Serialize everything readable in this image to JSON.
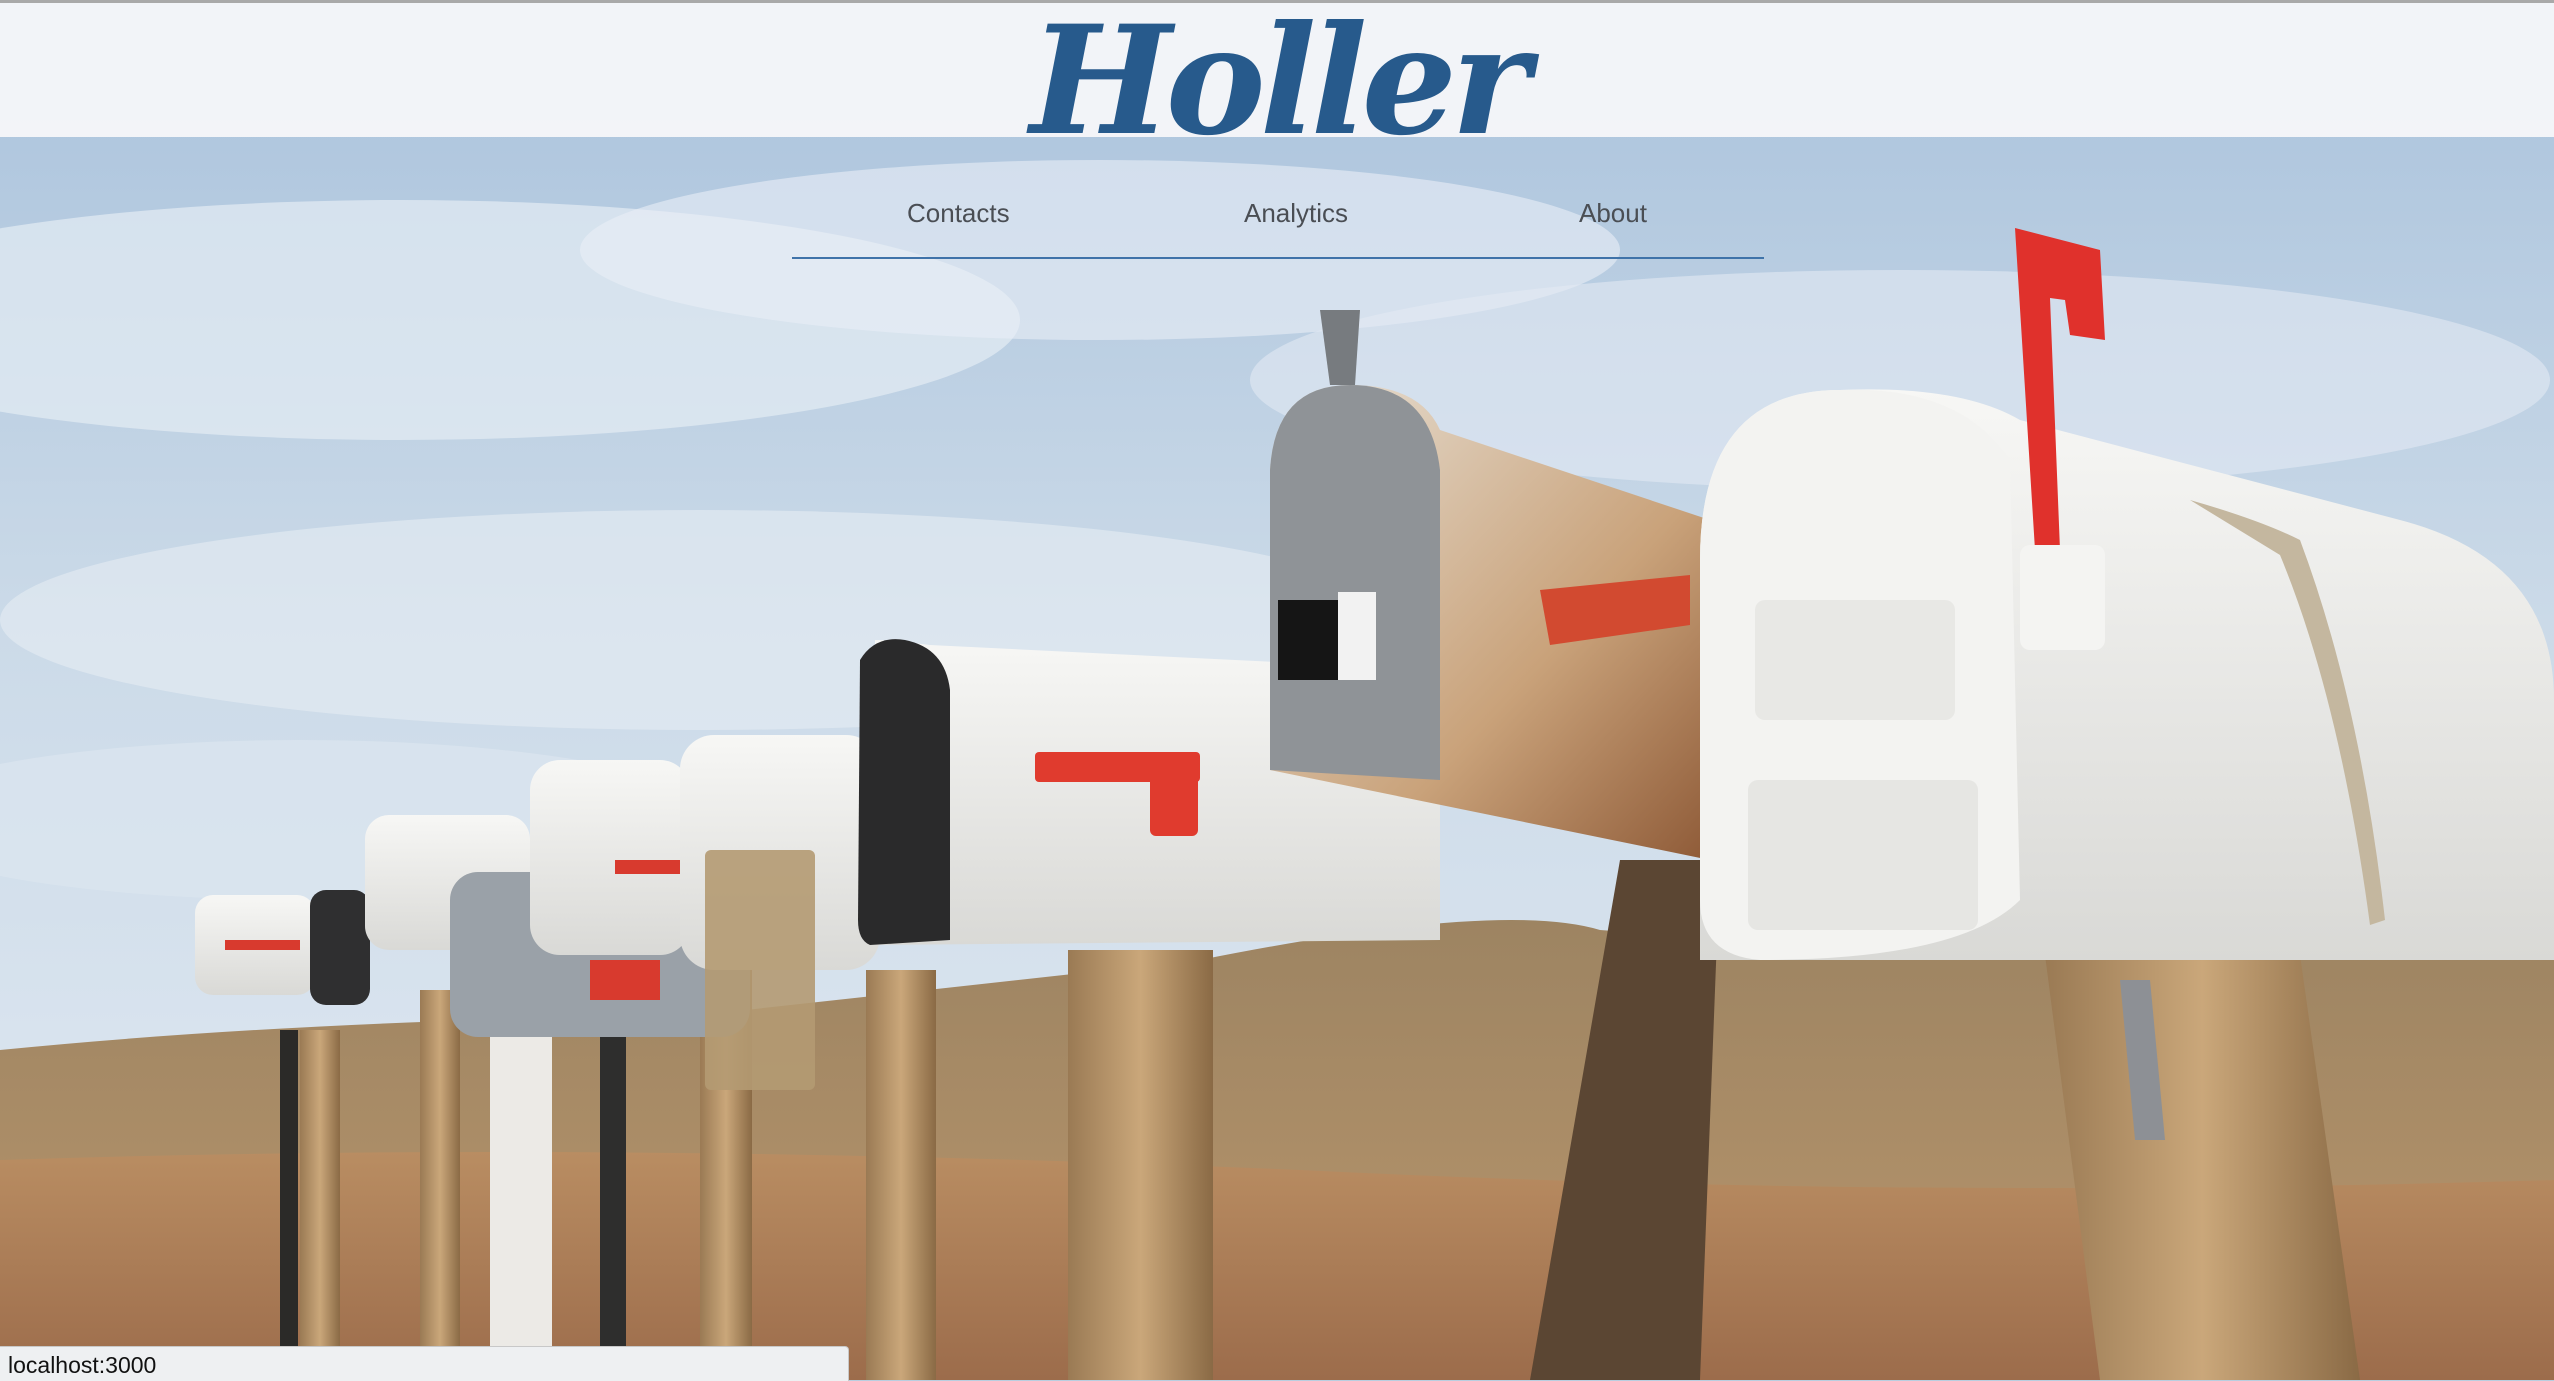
{
  "brand": {
    "name": "Holler",
    "color": "#275a8c"
  },
  "nav": {
    "items": [
      {
        "label": "Contacts"
      },
      {
        "label": "Analytics"
      },
      {
        "label": "About"
      }
    ],
    "underline_color": "#3f73a9"
  },
  "hero": {
    "subject": "row of rural mailboxes on wooden posts in the desert"
  },
  "status_bar": {
    "url": "localhost:3000"
  }
}
